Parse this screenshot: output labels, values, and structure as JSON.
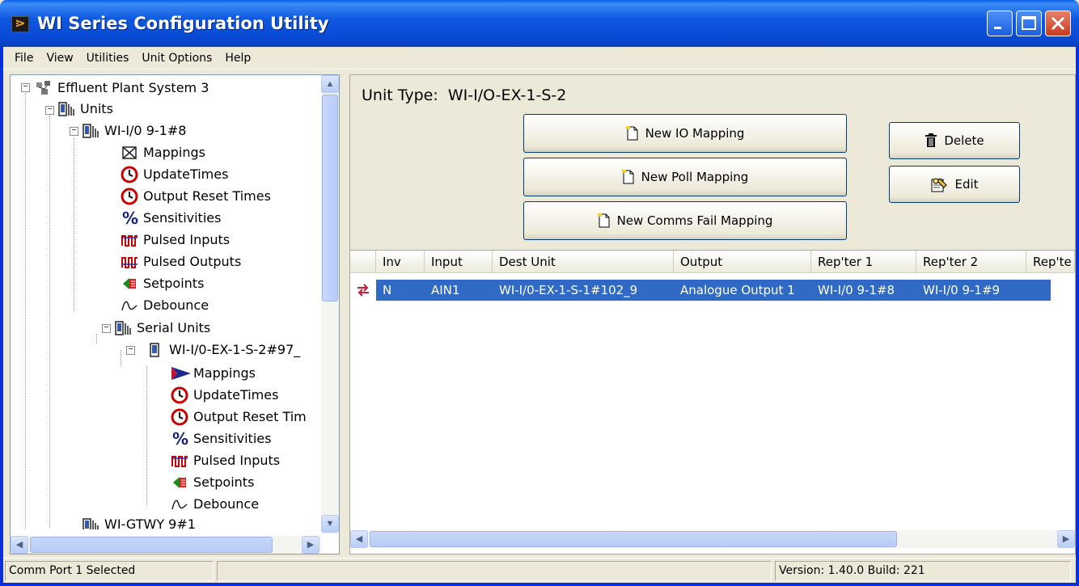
{
  "window": {
    "title": "WI Series Configuration Utility",
    "app_icon_glyph": "⋗",
    "title_color": "#0a246a"
  },
  "menu": [
    "File",
    "View",
    "Utilities",
    "Unit Options",
    "Help"
  ],
  "tree": {
    "root": "Effluent Plant System 3",
    "units_label": "Units",
    "unit1": "WI-I/0 9-1#8",
    "unit1_children": [
      "Mappings",
      "UpdateTimes",
      "Output Reset Times",
      "Sensitivities",
      "Pulsed Inputs",
      "Pulsed Outputs",
      "Setpoints",
      "Debounce"
    ],
    "serial_units": "Serial Units",
    "serial_unit1": "WI-I/0-EX-1-S-2#97_",
    "serial_children": [
      "Mappings",
      "UpdateTimes",
      "Output Reset Tim",
      "Sensitivities",
      "Pulsed Inputs",
      "Setpoints",
      "Debounce"
    ],
    "partial_next": "WI-GTWY 9#1"
  },
  "right": {
    "unit_type_label": "Unit Type:",
    "unit_type_value": "WI-I/O-EX-1-S-2",
    "buttons": {
      "new_io": "New IO Mapping",
      "new_poll": "New Poll Mapping",
      "new_comms": "New Comms Fail Mapping",
      "delete": "Delete",
      "edit": "Edit"
    },
    "columns": [
      "Inv",
      "Input",
      "Dest Unit",
      "Output",
      "Rep'ter 1",
      "Rep'ter 2",
      "Rep'te"
    ],
    "rows": [
      {
        "inv": "N",
        "input": "AIN1",
        "dest": "WI-I/0-EX-1-S-1#102_9",
        "output": "Analogue Output 1",
        "rep1": "WI-I/0 9-1#8",
        "rep2": "WI-I/0 9-1#9",
        "rep3": ""
      }
    ],
    "selection_color": "#316ac5"
  },
  "status": {
    "left": "Comm Port 1 Selected",
    "middle": "",
    "right": "Version: 1.40.0 Build: 221"
  }
}
